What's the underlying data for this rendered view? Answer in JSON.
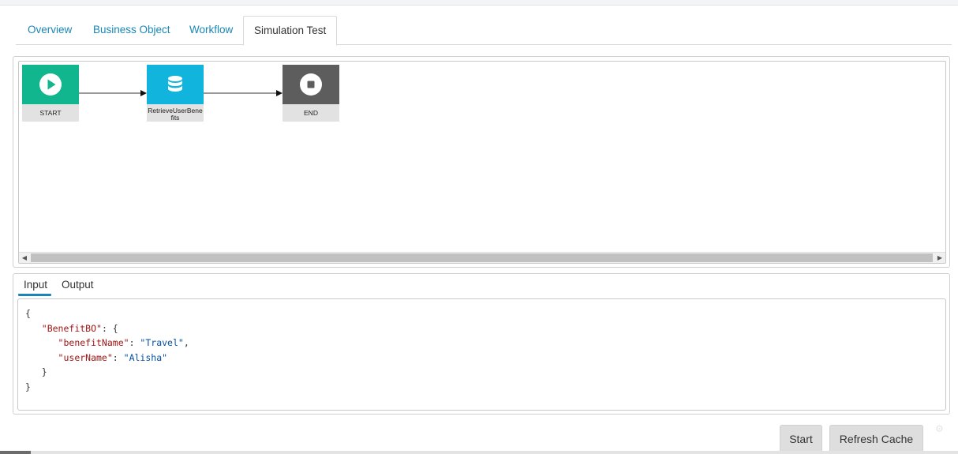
{
  "tabs": [
    {
      "label": "Overview",
      "active": false
    },
    {
      "label": "Business Object",
      "active": false
    },
    {
      "label": "Workflow",
      "active": false
    },
    {
      "label": "Simulation Test",
      "active": true
    }
  ],
  "workflow": {
    "nodes": [
      {
        "label": "START",
        "type": "start",
        "icon": "play-icon",
        "color": "#11b58e"
      },
      {
        "label": "RetrieveUserBenefits",
        "type": "task",
        "icon": "database-icon",
        "color": "#10b4dc"
      },
      {
        "label": "END",
        "type": "end",
        "icon": "stop-icon",
        "color": "#5d5d5d"
      }
    ]
  },
  "io": {
    "tabs": [
      {
        "label": "Input",
        "active": true
      },
      {
        "label": "Output",
        "active": false
      }
    ],
    "input_lines": [
      [
        {
          "t": "p",
          "v": "{"
        }
      ],
      [
        {
          "t": "p",
          "v": "   "
        },
        {
          "t": "k",
          "v": "\"BenefitBO\""
        },
        {
          "t": "p",
          "v": ": {"
        }
      ],
      [
        {
          "t": "p",
          "v": "      "
        },
        {
          "t": "k",
          "v": "\"benefitName\""
        },
        {
          "t": "p",
          "v": ": "
        },
        {
          "t": "s",
          "v": "\"Travel\""
        },
        {
          "t": "p",
          "v": ","
        }
      ],
      [
        {
          "t": "p",
          "v": "      "
        },
        {
          "t": "k",
          "v": "\"userName\""
        },
        {
          "t": "p",
          "v": ": "
        },
        {
          "t": "s",
          "v": "\"Alisha\""
        }
      ],
      [
        {
          "t": "p",
          "v": "   }"
        }
      ],
      [
        {
          "t": "p",
          "v": "}"
        }
      ]
    ]
  },
  "buttons": {
    "start": "Start",
    "refresh_cache": "Refresh Cache"
  },
  "colors": {
    "accent": "#1a86b5"
  }
}
